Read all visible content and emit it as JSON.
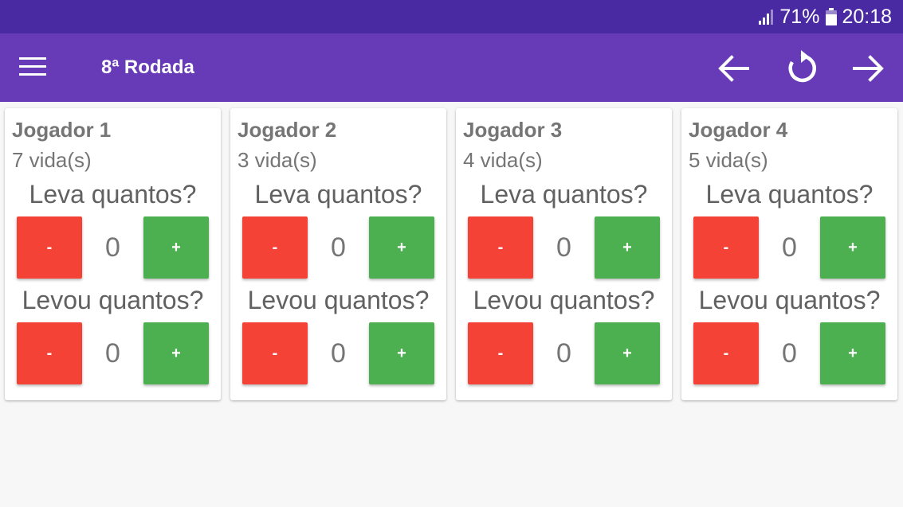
{
  "status_bar": {
    "battery_percent": "71%",
    "time": "20:18",
    "signal_icon": "signal-icon",
    "battery_icon": "battery-icon"
  },
  "app_bar": {
    "title": "8ª Rodada",
    "menu_icon": "menu-icon",
    "actions": [
      "arrow-back-icon",
      "refresh-icon",
      "arrow-forward-icon"
    ]
  },
  "colors": {
    "status_bar": "#4a2aa3",
    "app_bar": "#673ab7",
    "minus_button": "#f44336",
    "plus_button": "#4caf50",
    "background": "#f7f7f7"
  },
  "players": [
    {
      "name": "Jogador 1",
      "lives": "7 vida(s)",
      "bet_question": "Leva quantos?",
      "bet_value": "0",
      "won_question": "Levou quantos?",
      "won_value": "0",
      "minus_label": "-",
      "plus_label": "+"
    },
    {
      "name": "Jogador 2",
      "lives": "3 vida(s)",
      "bet_question": "Leva quantos?",
      "bet_value": "0",
      "won_question": "Levou quantos?",
      "won_value": "0",
      "minus_label": "-",
      "plus_label": "+"
    },
    {
      "name": "Jogador 3",
      "lives": "4 vida(s)",
      "bet_question": "Leva quantos?",
      "bet_value": "0",
      "won_question": "Levou quantos?",
      "won_value": "0",
      "minus_label": "-",
      "plus_label": "+"
    },
    {
      "name": "Jogador 4",
      "lives": "5 vida(s)",
      "bet_question": "Leva quantos?",
      "bet_value": "0",
      "won_question": "Levou quantos?",
      "won_value": "0",
      "minus_label": "-",
      "plus_label": "+"
    }
  ]
}
